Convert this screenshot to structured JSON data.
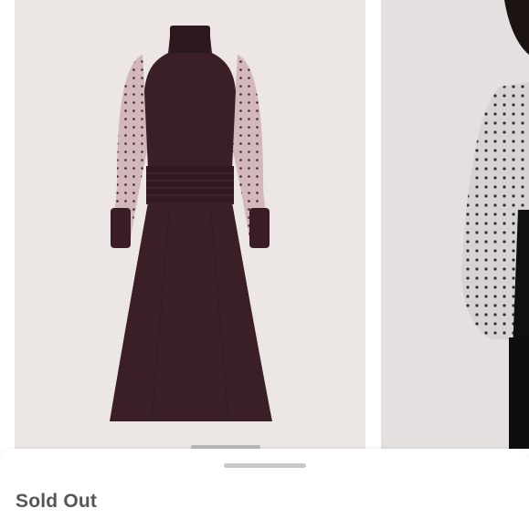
{
  "listing": {
    "status": "Sold Out",
    "images": [
      {
        "icon": "dress-product-photo",
        "background": "#ece6e5",
        "garment_color": "#3b1f27"
      },
      {
        "icon": "model-photo",
        "background": "#e3e0df",
        "garment_color": "#111111"
      }
    ]
  }
}
